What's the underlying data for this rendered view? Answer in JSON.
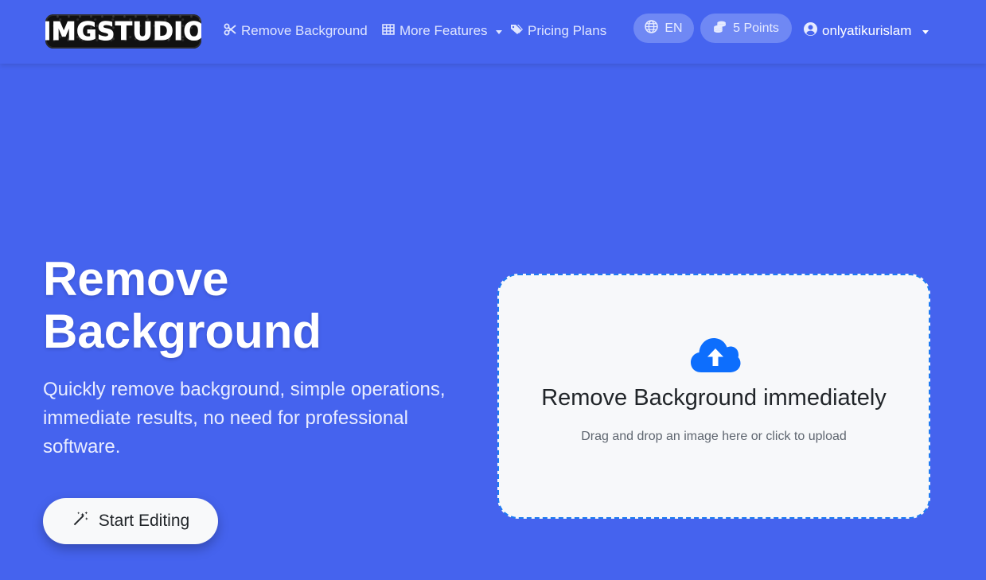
{
  "brand": {
    "logo_text": "IMGSTUDIO"
  },
  "nav": {
    "links": [
      {
        "label": "Remove Background",
        "icon": "scissors-icon"
      },
      {
        "label": "More Features",
        "icon": "grid-icon",
        "dropdown": true
      },
      {
        "label": "Pricing Plans",
        "icon": "tags-icon"
      }
    ],
    "language": {
      "label": "EN",
      "icon": "globe-icon"
    },
    "points": {
      "label": "5 Points",
      "icon": "coins-icon"
    },
    "user": {
      "name": "onlyatikurislam",
      "icon": "user-circle-icon"
    }
  },
  "hero": {
    "title": "Remove Background",
    "subtitle": "Quickly remove background, simple operations, immediate results, no need for professional software.",
    "cta_label": "Start Editing"
  },
  "upload": {
    "title": "Remove Background immediately",
    "hint": "Drag and drop an image here or click to upload",
    "icon": "cloud-upload-icon"
  },
  "colors": {
    "background": "#4563EE",
    "pill": "#6F88F4",
    "upload_border": "#1E7BF2",
    "upload_icon": "#0D6EFD"
  }
}
